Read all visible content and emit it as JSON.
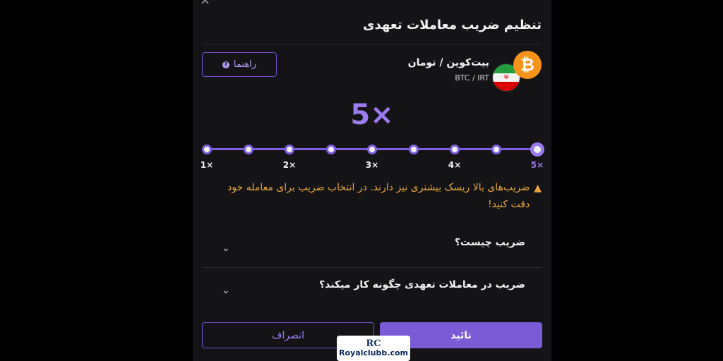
{
  "modal": {
    "title": "تنظیم ضریب معاملات تعهدی",
    "close_icon": "×"
  },
  "guide_button": {
    "label": "راهنما",
    "icon": "help-circle-icon"
  },
  "pair": {
    "name": "بیت‌کوین / تومان",
    "symbol": "BTC / IRT",
    "base_icon": "bitcoin-icon",
    "quote_icon": "iran-flag-icon"
  },
  "leverage": {
    "current": "5×",
    "selected_index": 8,
    "steps": 9,
    "labels": [
      "1×",
      "2×",
      "3×",
      "4×",
      "5×"
    ]
  },
  "warning": {
    "icon": "warning-icon",
    "text": "ضریب‌های بالا ریسک بیشتری نیز دارند. در انتخاب ضریب برای معامله خود دقت کنید!"
  },
  "faq": [
    {
      "question": "ضریب چیست؟"
    },
    {
      "question": "ضریب در معاملات تعهدی چگونه کار میکند؟"
    }
  ],
  "actions": {
    "cancel": "انصراف",
    "confirm": "تائید"
  },
  "watermark": {
    "logo": "RC",
    "text": "Royalclubb.com"
  },
  "colors": {
    "accent": "#7b5ad6",
    "warning": "#e9a73b",
    "background": "#141417",
    "bitcoin": "#f7931a"
  }
}
